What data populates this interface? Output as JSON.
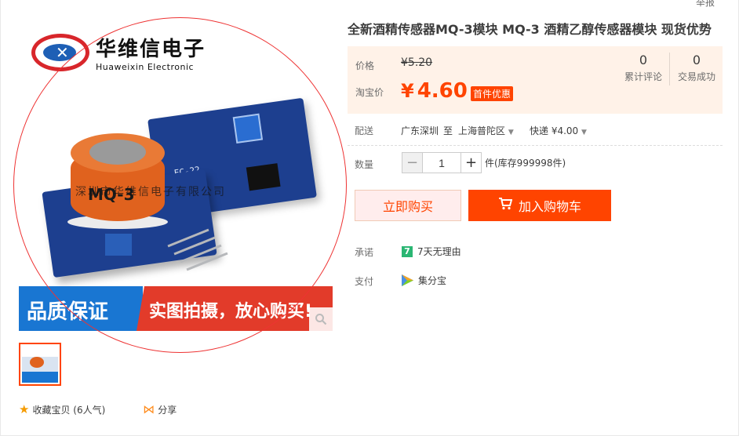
{
  "header": {
    "report_link": "举报"
  },
  "gallery": {
    "brand_cn": "华维信电子",
    "brand_en": "Huaweixin Electronic",
    "board_label": "FC-22",
    "sensor_label": "MQ-3",
    "watermark": "深圳市华维信电子有限公司",
    "banner_left": "品质保证",
    "banner_right": "实图拍摄，放心购买!",
    "zoom_icon": "magnifier-icon"
  },
  "actions": {
    "favorite_label": "收藏宝贝",
    "favorite_count": "(6人气)",
    "share_label": "分享"
  },
  "product": {
    "title": "全新酒精传感器MQ-3模块 MQ-3 酒精乙醇传感器模块 现货优势",
    "price_label": "价格",
    "original_price": "¥5.20",
    "taobao_price_label": "淘宝价",
    "currency_symbol": "¥",
    "promo_price": "4.60",
    "promo_tag": "首件优惠",
    "reviews_count": "0",
    "reviews_label": "累计评论",
    "sales_count": "0",
    "sales_label": "交易成功"
  },
  "delivery": {
    "label": "配送",
    "from": "广东深圳",
    "to_word": "至",
    "destination": "上海普陀区",
    "shipping": "快递 ¥4.00"
  },
  "quantity": {
    "label": "数量",
    "value": "1",
    "minus": "−",
    "plus": "+",
    "stock": "件(库存999998件)"
  },
  "buttons": {
    "buy_now": "立即购买",
    "add_to_cart": "加入购物车"
  },
  "promise": {
    "label": "承诺",
    "badge": "7",
    "text": "7天无理由"
  },
  "payment": {
    "label": "支付",
    "text": "集分宝"
  },
  "colors": {
    "accent": "#ff4400",
    "price_bg": "#fff2e8",
    "banner_blue": "#1976d2",
    "banner_red": "#e23b2a"
  }
}
